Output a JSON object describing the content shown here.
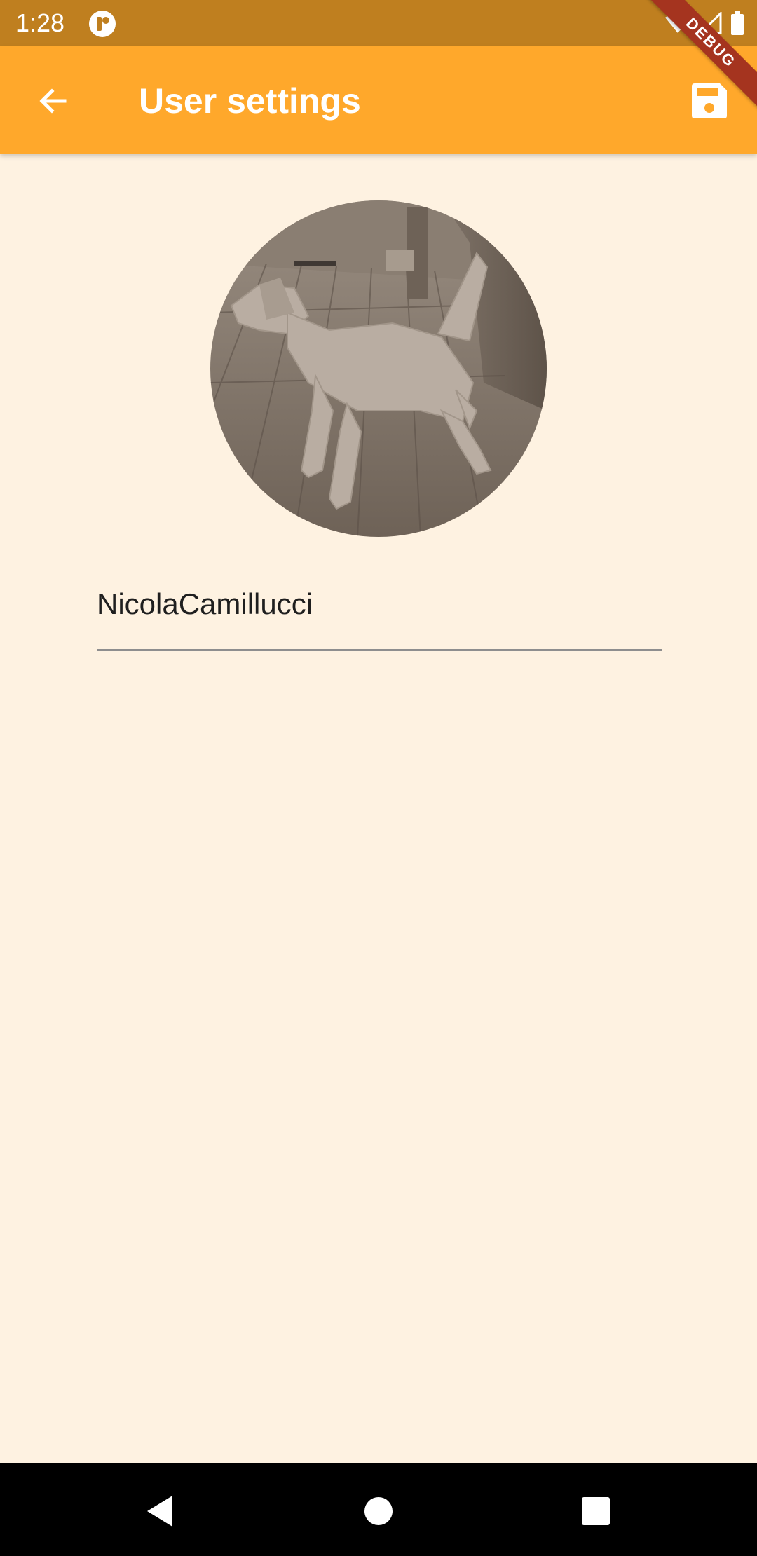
{
  "status_bar": {
    "time": "1:28",
    "background": "#BF7F1F"
  },
  "debug_banner": {
    "label": "DEBUG",
    "color": "#A5341F"
  },
  "app_bar": {
    "title": "User settings",
    "background": "#FFA82B",
    "back_icon": "arrow-back-icon",
    "save_icon": "floppy-disk-save-icon"
  },
  "profile": {
    "avatar_subject": "low-poly dog in wooden room",
    "username_value": "NicolaCamillucci"
  },
  "page": {
    "background": "#FEF2E1"
  },
  "nav_bar": {
    "back_icon": "triangle-back-icon",
    "home_icon": "circle-home-icon",
    "recents_icon": "square-recents-icon"
  }
}
